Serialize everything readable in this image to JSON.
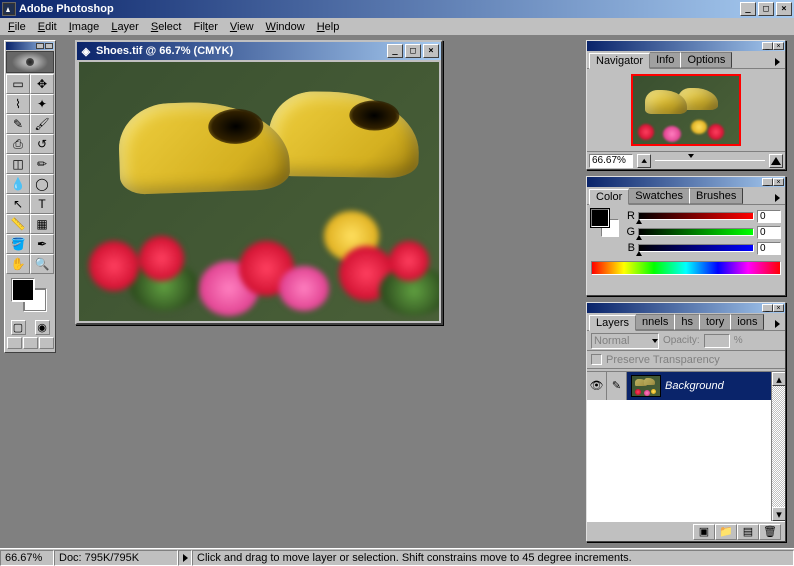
{
  "app": {
    "title": "Adobe Photoshop"
  },
  "menu": {
    "items": [
      {
        "label": "File",
        "u": "F"
      },
      {
        "label": "Edit",
        "u": "E"
      },
      {
        "label": "Image",
        "u": "I"
      },
      {
        "label": "Layer",
        "u": "L"
      },
      {
        "label": "Select",
        "u": "S"
      },
      {
        "label": "Filter",
        "u": "F"
      },
      {
        "label": "View",
        "u": "V"
      },
      {
        "label": "Window",
        "u": "W"
      },
      {
        "label": "Help",
        "u": "H"
      }
    ]
  },
  "tools": {
    "rows": [
      [
        "marquee-icon",
        "move-icon"
      ],
      [
        "lasso-icon",
        "wand-icon"
      ],
      [
        "airbrush-icon",
        "paintbrush-icon"
      ],
      [
        "stamp-icon",
        "history-brush-icon"
      ],
      [
        "eraser-icon",
        "pencil-icon"
      ],
      [
        "blur-icon",
        "dodge-icon"
      ],
      [
        "pen-icon",
        "type-icon"
      ],
      [
        "measure-icon",
        "gradient-icon"
      ],
      [
        "bucket-icon",
        "eyedropper-icon"
      ],
      [
        "hand-icon",
        "zoom-icon"
      ]
    ],
    "fg_color": "#000000",
    "bg_color": "#ffffff"
  },
  "document": {
    "title": "Shoes.tif @ 66.7% (CMYK)"
  },
  "navigator": {
    "tabs": [
      "Navigator",
      "Info",
      "Options"
    ],
    "active_tab": 0,
    "zoom_value": "66.67%"
  },
  "color_panel": {
    "tabs": [
      "Color",
      "Swatches",
      "Brushes"
    ],
    "active_tab": 0,
    "channels": [
      {
        "label": "R",
        "value": "0"
      },
      {
        "label": "G",
        "value": "0"
      },
      {
        "label": "B",
        "value": "0"
      }
    ]
  },
  "layers_panel": {
    "tabs": [
      "Layers",
      "nnels",
      "hs",
      "tory",
      "ions"
    ],
    "active_tab": 0,
    "blend_mode": "Normal",
    "opacity_label": "Opacity:",
    "opacity_pct_suffix": "%",
    "preserve_label": "Preserve Transparency",
    "layers": [
      {
        "name": "Background",
        "visible": true
      }
    ]
  },
  "status": {
    "zoom": "66.67%",
    "doc": "Doc: 795K/795K",
    "hint": "Click and drag to move layer or selection. Shift constrains move to 45 degree increments."
  }
}
